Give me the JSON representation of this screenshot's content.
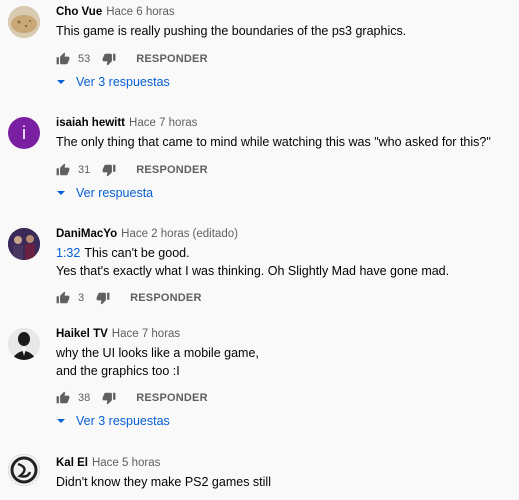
{
  "comments": [
    {
      "author": "Cho Vue",
      "time": "Hace 6 horas",
      "text": "This game is really pushing the boundaries of the ps3 graphics.",
      "likes": "53",
      "reply_label": "RESPONDER",
      "replies_label": "Ver 3 respuestas",
      "avatar": "potato-photo-avatar"
    },
    {
      "author": "isaiah hewitt",
      "time": "Hace 7 horas",
      "text": "The only thing that came to mind while watching this was \"who asked for this?\"",
      "likes": "31",
      "reply_label": "RESPONDER",
      "replies_label": "Ver respuesta",
      "avatar_letter": "i",
      "avatar_color": "#7b1fa2"
    },
    {
      "author": "DaniMacYo",
      "time": "Hace 2 horas",
      "edited": "(editado)",
      "timestamp": "1:32",
      "text_line1": "This can't be good.",
      "text_line2": "Yes that's exactly what I was thinking. Oh Slightly Mad have gone mad.",
      "likes": "3",
      "reply_label": "RESPONDER",
      "avatar": "group-photo-avatar"
    },
    {
      "author": "Haikel TV",
      "time": "Hace 7 horas",
      "text_line1": "why the UI looks like a mobile game,",
      "text_line2": "and the graphics too :I",
      "likes": "38",
      "reply_label": "RESPONDER",
      "replies_label": "Ver 3 respuestas",
      "avatar": "suit-person-avatar"
    },
    {
      "author": "Kal El",
      "time": "Hace 5 horas",
      "text": "Didn't know they make PS2 games still",
      "avatar": "swirl-logo-avatar"
    }
  ],
  "colors": {
    "link_blue": "#065fd4",
    "secondary_text": "#606060",
    "background": "#f9f9f9"
  },
  "icons": [
    "thumb-up-icon",
    "thumb-down-icon",
    "caret-down-icon"
  ]
}
